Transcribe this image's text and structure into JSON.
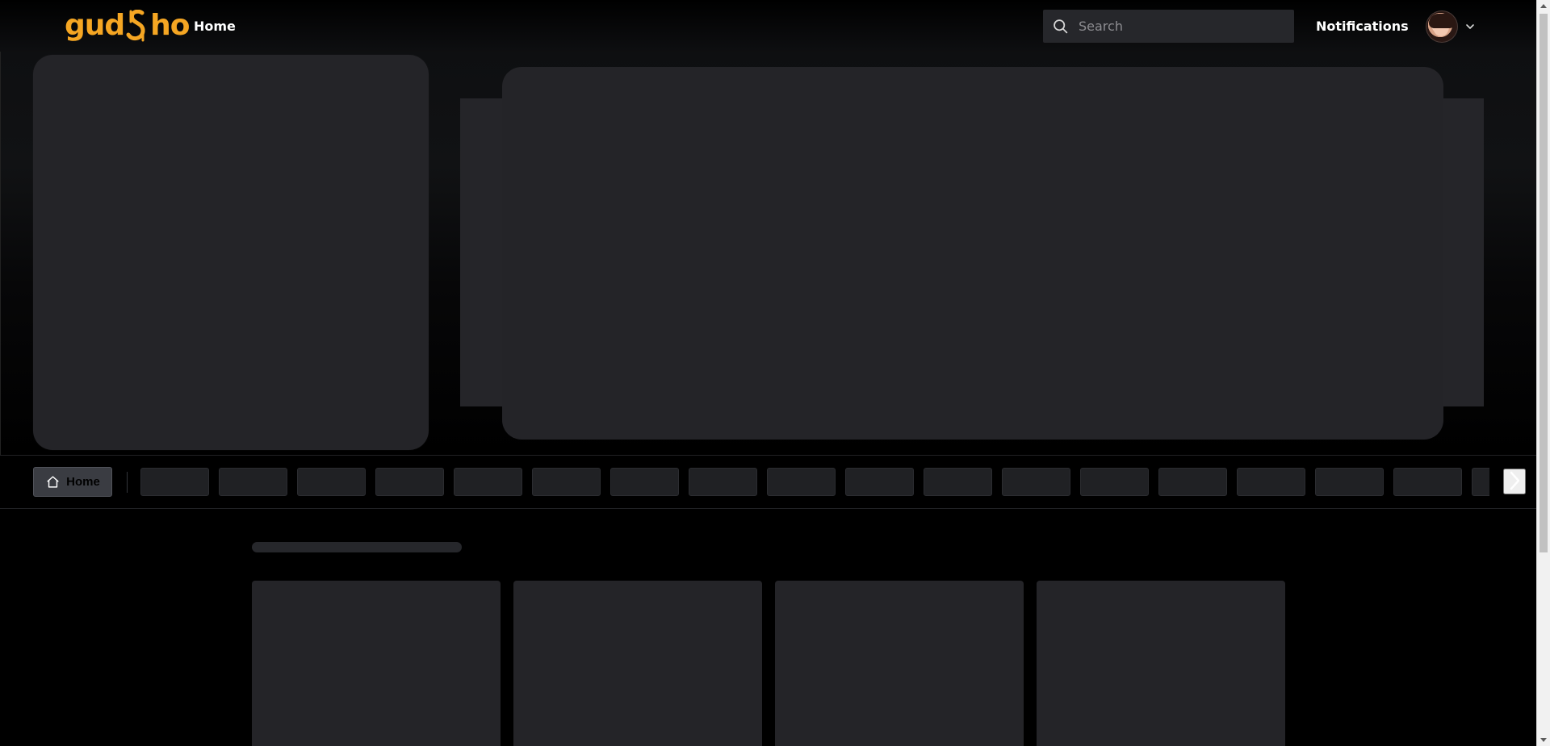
{
  "header": {
    "logo_text": "gudsho",
    "home_label": "Home",
    "search_placeholder": "Search",
    "notifications_label": "Notifications",
    "avatar_name": "profile avatar"
  },
  "chips_bar": {
    "home_label": "Home",
    "chip_count": 18
  },
  "icons": {
    "search": "search-icon",
    "home": "home-icon",
    "chevron_down": "chevron-down-icon",
    "next": "chevron-right-icon"
  },
  "colors": {
    "brand": "#f5a623",
    "background": "#000000",
    "skeleton": "#242428",
    "search_bg": "#26272b"
  }
}
